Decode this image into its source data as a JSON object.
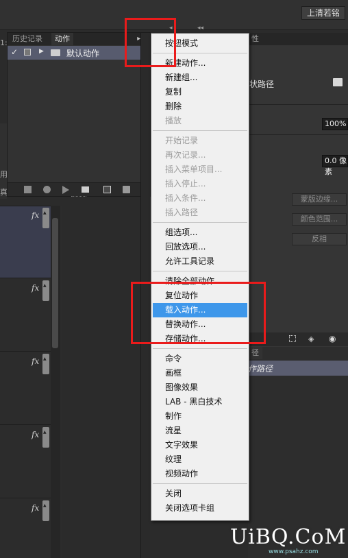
{
  "top_bar": {
    "user_button": "上清若铭",
    "arrow_left": "◂",
    "arrow_collapse": "◂◂"
  },
  "panel": {
    "tabs": [
      "历史记录",
      "动作"
    ],
    "menu_icon": "▸≡",
    "action_set": {
      "checked": "✓",
      "label": "默认动作"
    }
  },
  "left_slivers": [
    "1:",
    "用",
    "真"
  ],
  "layers": {
    "fx_label": "fx",
    "rows": 5
  },
  "right_panel": {
    "tab_fragment": "性",
    "path_label": "状路径",
    "percent": "100%",
    "feather": "0.0 像素",
    "buttons": [
      "蒙版边缘...",
      "颜色范围...",
      "反相"
    ],
    "paths_tab": "径",
    "work_path": "作路径"
  },
  "menu": {
    "items": [
      {
        "label": "按钮模式",
        "disabled": false
      },
      {
        "sep": true
      },
      {
        "label": "新建动作...",
        "disabled": false
      },
      {
        "label": "新建组...",
        "disabled": false
      },
      {
        "label": "复制",
        "disabled": false
      },
      {
        "label": "删除",
        "disabled": false
      },
      {
        "label": "播放",
        "disabled": true
      },
      {
        "sep": true
      },
      {
        "label": "开始记录",
        "disabled": true
      },
      {
        "label": "再次记录...",
        "disabled": true
      },
      {
        "label": "插入菜单项目...",
        "disabled": true
      },
      {
        "label": "插入停止...",
        "disabled": true
      },
      {
        "label": "插入条件...",
        "disabled": true
      },
      {
        "label": "插入路径",
        "disabled": true
      },
      {
        "sep": true
      },
      {
        "label": "组选项...",
        "disabled": false
      },
      {
        "label": "回放选项...",
        "disabled": false
      },
      {
        "label": "允许工具记录",
        "disabled": false
      },
      {
        "sep": true
      },
      {
        "label": "清除全部动作",
        "disabled": false
      },
      {
        "label": "复位动作",
        "disabled": false
      },
      {
        "label": "载入动作...",
        "disabled": false,
        "highlighted": true
      },
      {
        "label": "替换动作...",
        "disabled": false
      },
      {
        "label": "存储动作...",
        "disabled": false
      },
      {
        "sep": true
      },
      {
        "label": "命令",
        "disabled": false
      },
      {
        "label": "画框",
        "disabled": false
      },
      {
        "label": "图像效果",
        "disabled": false
      },
      {
        "label": "LAB - 黑白技术",
        "disabled": false
      },
      {
        "label": "制作",
        "disabled": false
      },
      {
        "label": "流星",
        "disabled": false
      },
      {
        "label": "文字效果",
        "disabled": false
      },
      {
        "label": "纹理",
        "disabled": false
      },
      {
        "label": "视频动作",
        "disabled": false
      },
      {
        "sep": true
      },
      {
        "label": "关闭",
        "disabled": false
      },
      {
        "label": "关闭选项卡组",
        "disabled": false
      }
    ]
  },
  "watermark": {
    "main": "UiBQ.CoM",
    "sub": "www.psahz.com"
  },
  "colors": {
    "highlight": "#3e97ea",
    "annotation": "#ea1b1b",
    "selected_row": "#575b6e"
  }
}
